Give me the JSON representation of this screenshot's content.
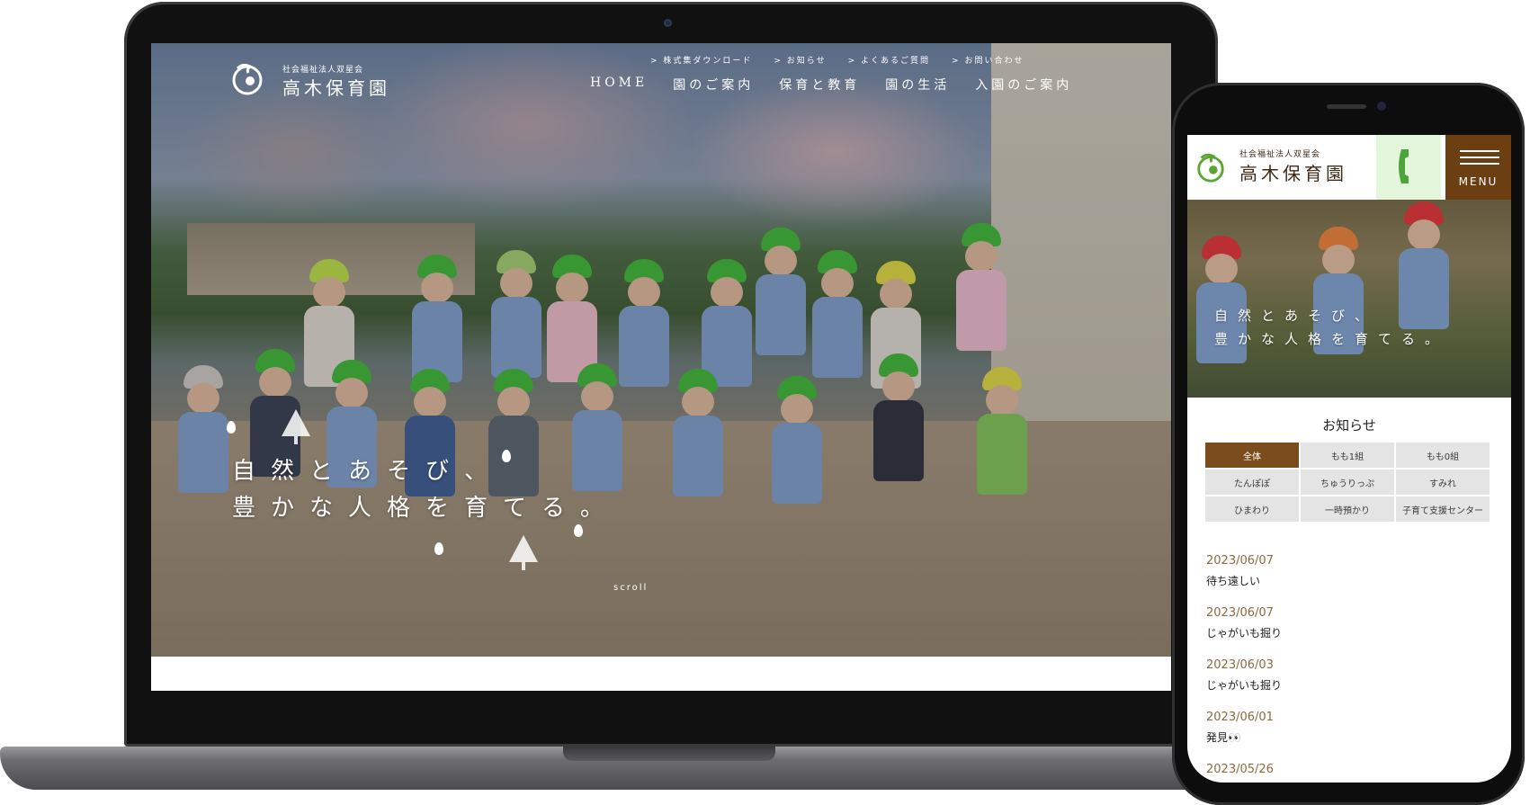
{
  "desktop": {
    "logo": {
      "small": "社会福祉法人双星会",
      "big": "高木保育園"
    },
    "subnav": [
      {
        "label": ">  株式集ダウンロード"
      },
      {
        "label": ">  お知らせ"
      },
      {
        "label": ">  よくあるご質問"
      },
      {
        "label": ">  お問い合わせ"
      }
    ],
    "mainnav": [
      {
        "label": "HOME"
      },
      {
        "label": "園のご案内"
      },
      {
        "label": "保育と教育"
      },
      {
        "label": "園の生活"
      },
      {
        "label": "入園のご案内"
      }
    ],
    "catch": {
      "line1": "自然とあそび、",
      "line2": "豊かな人格を育てる。"
    },
    "scroll": "scroll"
  },
  "mobile": {
    "logo": {
      "small": "社会福祉法人双星会",
      "big": "高木保育園"
    },
    "menu_label": "MENU",
    "catch": {
      "line1": "自然とあそび、",
      "line2": "豊かな人格を育てる。"
    },
    "news_title": "お知らせ",
    "tabs": [
      {
        "label": "全体",
        "active": true
      },
      {
        "label": "もも1組"
      },
      {
        "label": "もも0組"
      },
      {
        "label": "たんぽぽ"
      },
      {
        "label": "ちゅうりっぷ"
      },
      {
        "label": "すみれ"
      },
      {
        "label": "ひまわり"
      },
      {
        "label": "一時預かり"
      },
      {
        "label": "子育て支援センター"
      }
    ],
    "news": [
      {
        "date": "2023/06/07",
        "title": "待ち遠しい"
      },
      {
        "date": "2023/06/07",
        "title": "じゃがいも掘り"
      },
      {
        "date": "2023/06/03",
        "title": "じゃがいも掘り"
      },
      {
        "date": "2023/06/01",
        "title": "発見👀"
      },
      {
        "date": "2023/05/26",
        "title": ""
      }
    ]
  },
  "colors": {
    "brand_brown": "#6b3f12",
    "tab_active": "#7b4d1c",
    "tel_bg": "#e3f6dc",
    "hat_green": "#41b43a"
  },
  "icons": [
    "rooster-logo-icon",
    "phone-icon",
    "hamburger-icon",
    "tree-icon",
    "drop-icon"
  ]
}
